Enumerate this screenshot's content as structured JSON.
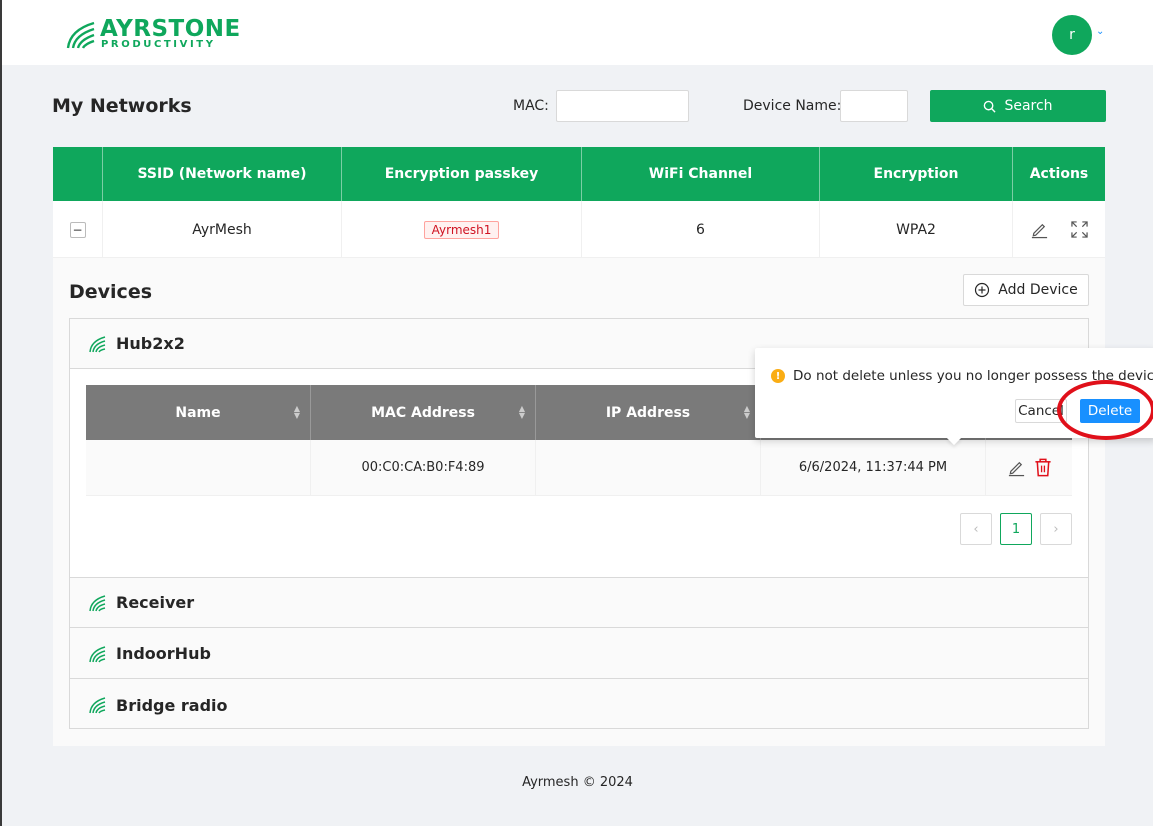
{
  "header": {
    "logo_main": "AYRSTONE",
    "logo_sub": "PRODUCTIVITY",
    "avatar_initial": "r",
    "avatar_caret": "⌄"
  },
  "page": {
    "title": "My Networks",
    "mac_label": "MAC:",
    "mac_value": "",
    "device_name_label": "Device Name:",
    "device_name_value": "",
    "search_label": "Search"
  },
  "networks_table": {
    "columns": [
      "",
      "SSID (Network name)",
      "Encryption passkey",
      "WiFi Channel",
      "Encryption",
      "Actions"
    ],
    "rows": [
      {
        "expand": "−",
        "ssid": "AyrMesh",
        "passkey": "Ayrmesh1",
        "channel": "6",
        "encryption": "WPA2"
      }
    ]
  },
  "devices": {
    "title": "Devices",
    "add_label": "Add Device",
    "groups": [
      {
        "name": "Hub2x2",
        "expanded": true
      },
      {
        "name": "Receiver",
        "expanded": false
      },
      {
        "name": "IndoorHub",
        "expanded": false
      },
      {
        "name": "Bridge radio",
        "expanded": false
      }
    ],
    "table": {
      "columns": [
        "Name",
        "MAC Address",
        "IP Address",
        "",
        ""
      ],
      "rows": [
        {
          "name": "",
          "mac": "00:C0:CA:B0:F4:89",
          "ip": "",
          "last_seen": "6/6/2024, 11:37:44 PM"
        }
      ]
    },
    "pagination": {
      "prev": "‹",
      "current": "1",
      "next": "›"
    }
  },
  "popconfirm": {
    "message": "Do not delete unless you no longer possess the device!",
    "cancel_label": "Cancel",
    "delete_label": "Delete"
  },
  "footer": {
    "text": "Ayrmesh © 2024"
  },
  "colors": {
    "brand_green": "#0fa75c",
    "primary_blue": "#1890ff",
    "danger_red": "#e0101a",
    "warning": "#faad14"
  }
}
